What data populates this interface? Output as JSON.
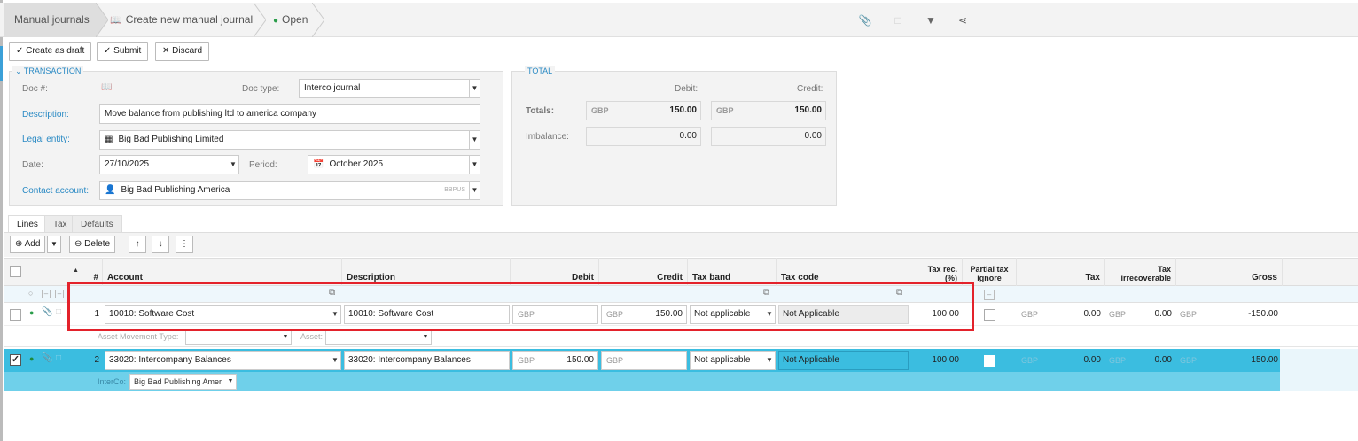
{
  "breadcrumb": {
    "item1": "Manual journals",
    "item2": "Create new manual journal",
    "item3": "Open"
  },
  "toolbar": {
    "create_draft": "Create as draft",
    "submit": "Submit",
    "discard": "Discard"
  },
  "transaction": {
    "legend": "TRANSACTION",
    "doc_no_label": "Doc #:",
    "doc_type_label": "Doc type:",
    "doc_type": "Interco journal",
    "description_label": "Description:",
    "description": "Move balance from publishing ltd to america company",
    "legal_entity_label": "Legal entity:",
    "legal_entity": "Big Bad Publishing Limited",
    "date_label": "Date:",
    "date": "27/10/2025",
    "period_label": "Period:",
    "period": "October 2025",
    "contact_label": "Contact account:",
    "contact": "Big Bad Publishing America",
    "contact_code": "BBPUS"
  },
  "total": {
    "legend": "TOTAL",
    "debit_label": "Debit:",
    "credit_label": "Credit:",
    "totals_label": "Totals:",
    "imbalance_label": "Imbalance:",
    "currency": "GBP",
    "debit_total": "150.00",
    "credit_total": "150.00",
    "imbalance_debit": "0.00",
    "imbalance_credit": "0.00"
  },
  "tabs": [
    "Lines",
    "Tax",
    "Defaults"
  ],
  "lines_toolbar": {
    "add": "Add",
    "delete": "Delete"
  },
  "columns": {
    "hash": "#",
    "account": "Account",
    "description": "Description",
    "debit": "Debit",
    "credit": "Credit",
    "tax_band": "Tax band",
    "tax_code": "Tax code",
    "tax_rec": "Tax rec. (%)",
    "partial_tax": "Partial tax ignore",
    "tax": "Tax",
    "tax_irrecoverable": "Tax irrecoverable",
    "gross": "Gross"
  },
  "lines": [
    {
      "no": "1",
      "account": "10010: Software Cost",
      "description": "10010: Software Cost",
      "debit_currency": "GBP",
      "debit": "",
      "credit_currency": "GBP",
      "credit": "150.00",
      "tax_band": "Not applicable",
      "tax_code": "Not Applicable",
      "tax_rec": "100.00",
      "tax_currency": "GBP",
      "tax": "0.00",
      "irr_currency": "GBP",
      "irr": "0.00",
      "gross_currency": "GBP",
      "gross": "-150.00",
      "sub_label1": "Asset Movement Type:",
      "sub_label2": "Asset:"
    },
    {
      "no": "2",
      "account": "33020: Intercompany Balances",
      "description": "33020: Intercompany Balances",
      "debit_currency": "GBP",
      "debit": "150.00",
      "credit_currency": "GBP",
      "credit": "",
      "tax_band": "Not applicable",
      "tax_code": "Not Applicable",
      "tax_rec": "100.00",
      "tax_currency": "GBP",
      "tax": "0.00",
      "irr_currency": "GBP",
      "irr": "0.00",
      "gross_currency": "GBP",
      "gross": "150.00",
      "sub_label": "InterCo:",
      "interco": "Big Bad Publishing Amer"
    }
  ],
  "colors": {
    "accent": "#2a8ac4",
    "selected_row": "#3bbde0",
    "highlight": "#e3222b",
    "status_open": "#2a9d4a"
  }
}
